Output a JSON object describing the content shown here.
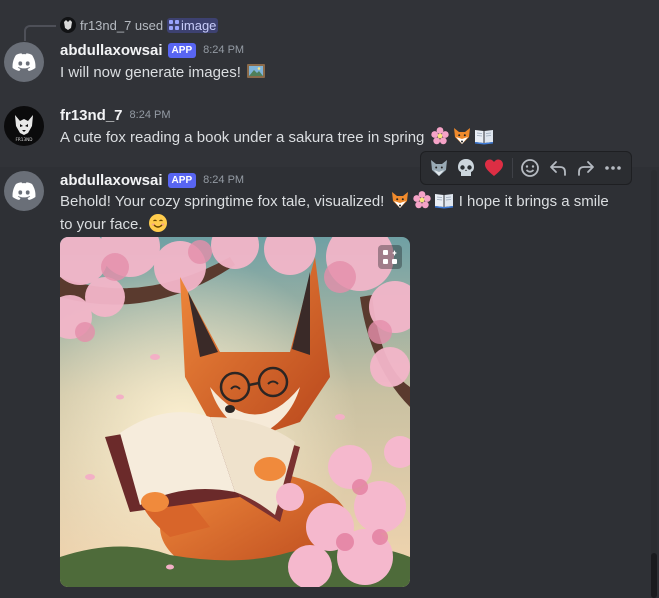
{
  "reply": {
    "user_text": "fr13nd_7 used",
    "command": "image"
  },
  "messages": [
    {
      "username": "abdullaxowsai",
      "badge": "APP",
      "time": "8:24 PM",
      "text": "I will now generate images!",
      "emoji": [
        "framed-picture"
      ]
    },
    {
      "username": "fr13nd_7",
      "time": "8:24 PM",
      "text": "A cute fox reading a book under a sakura tree in spring",
      "emoji": [
        "cherry-blossom",
        "fox",
        "open-book"
      ],
      "avatar_text": "FR13ND"
    },
    {
      "username": "abdullaxowsai",
      "badge": "APP",
      "time": "8:24 PM",
      "text_line1": "Behold! Your cozy springtime fox tale, visualized!",
      "text_line1_end": "I hope it brings a smile",
      "text_line2": "to your face.",
      "emoji": [
        "fox",
        "cherry-blossom",
        "open-book",
        "smiling-face"
      ]
    }
  ],
  "toolbar": {
    "reactions": [
      "wolf-emoji",
      "skull-emoji",
      "red-heart-emoji"
    ],
    "actions": [
      "add-reaction-icon",
      "reply-icon",
      "forward-icon",
      "more-icon"
    ]
  },
  "colors": {
    "background": "#313338",
    "hover": "#2e3035",
    "brand": "#5865f2",
    "username": "#f2f3f5",
    "text": "#dbdee1",
    "muted": "#949ba4"
  }
}
